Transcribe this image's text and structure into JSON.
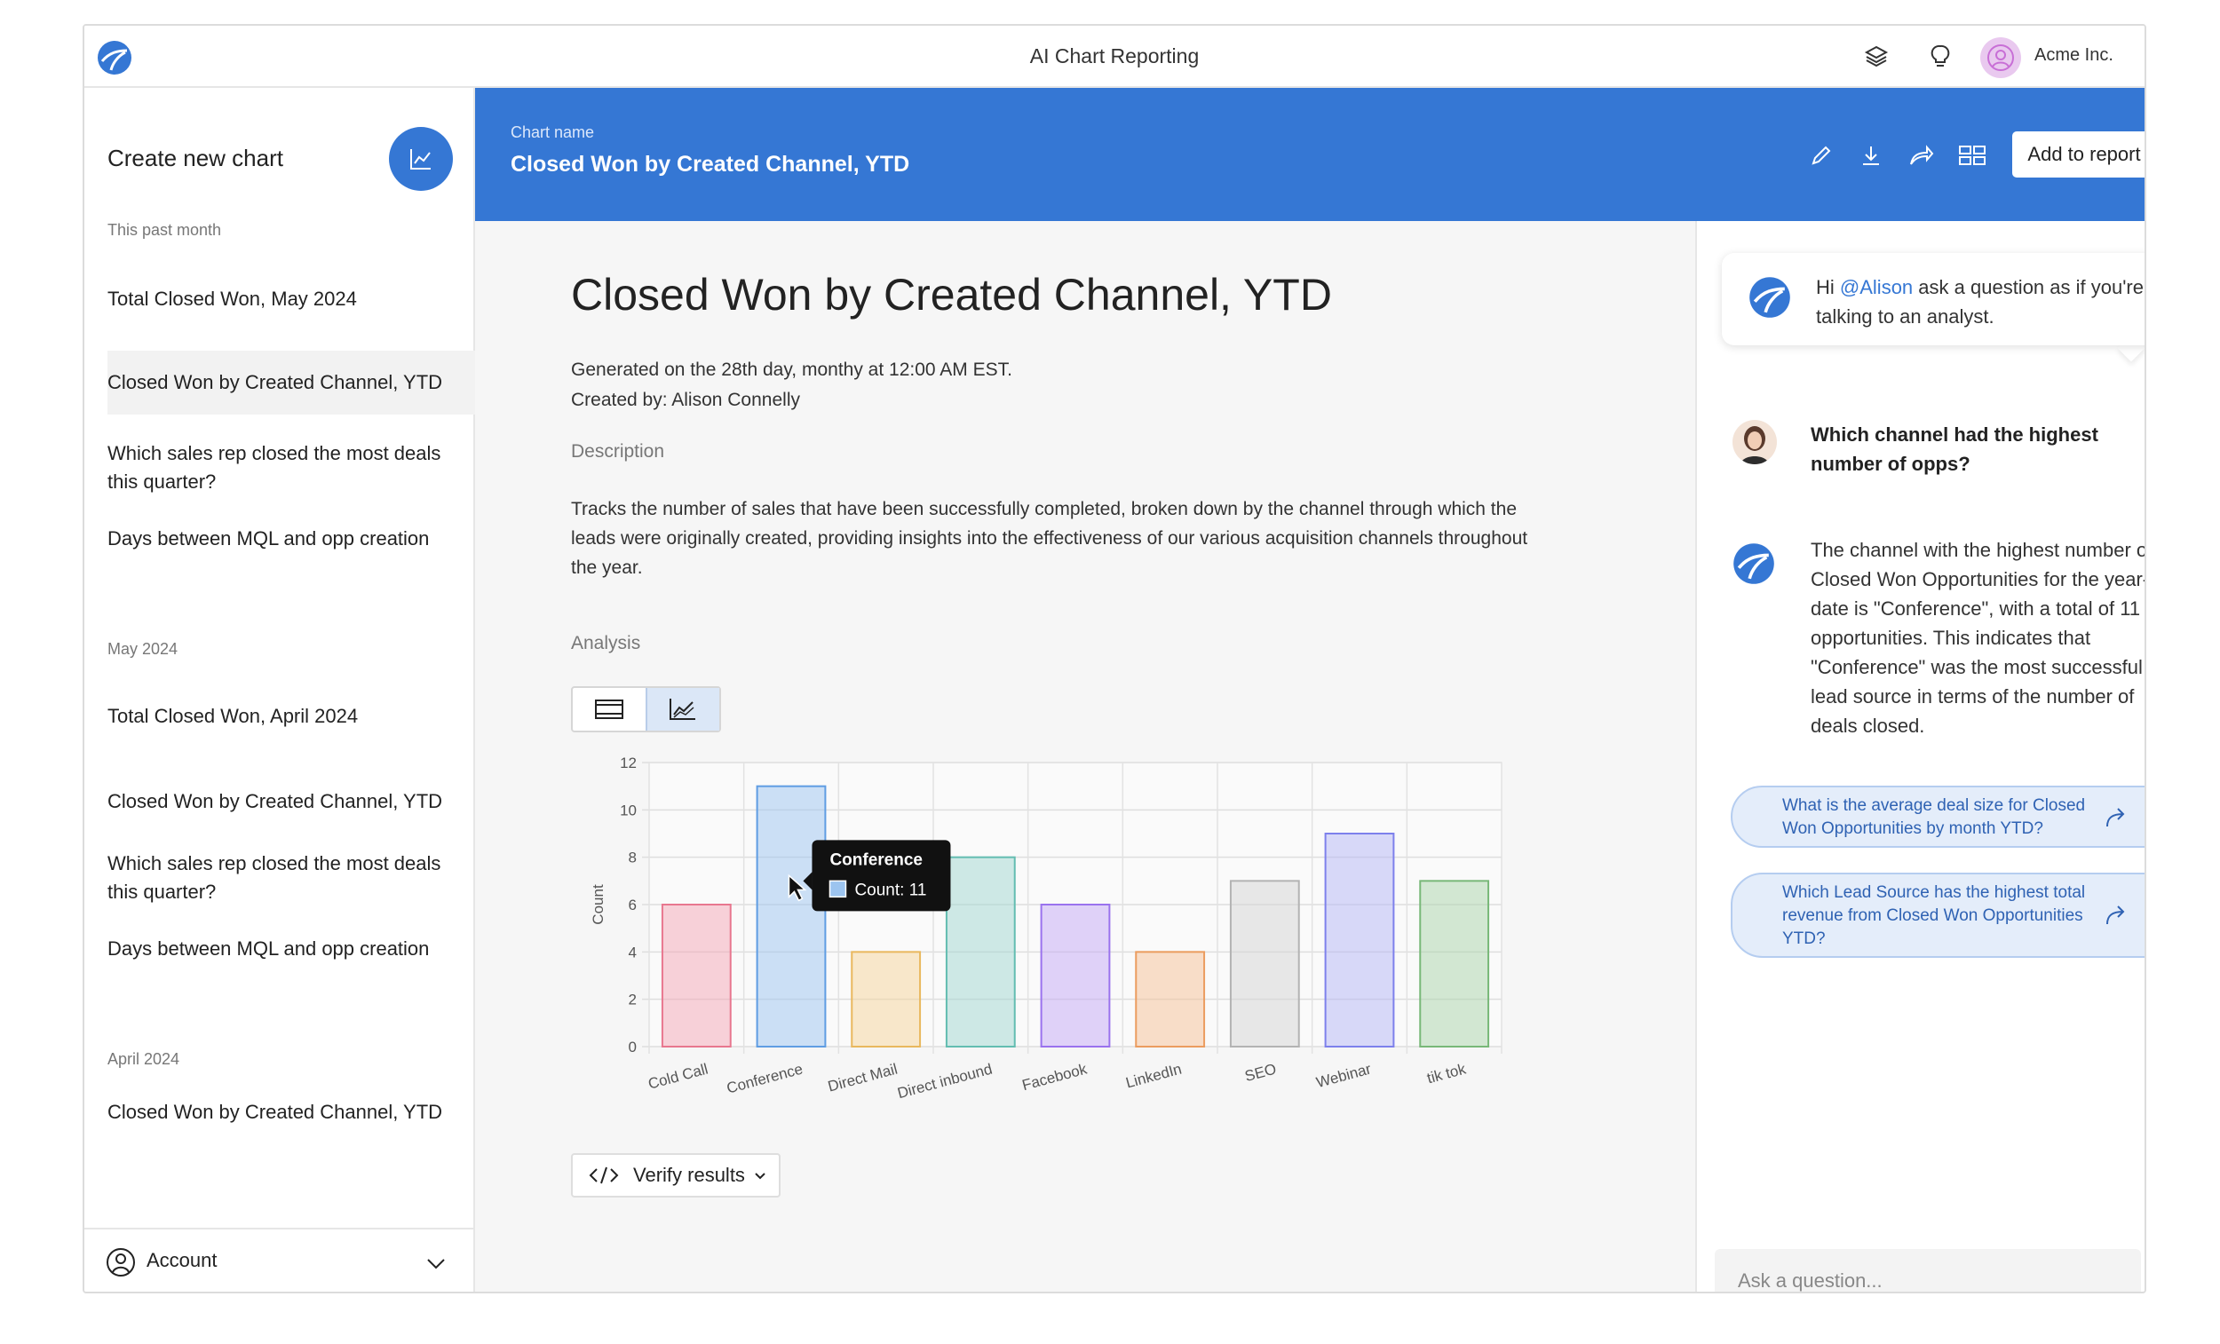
{
  "app": {
    "title": "AI Chart Reporting",
    "company": "Acme Inc."
  },
  "sidebar": {
    "create_label": "Create new chart",
    "sections": [
      {
        "label": "This past month",
        "items": [
          {
            "label": "Total Closed Won, May 2024"
          },
          {
            "label": "Closed Won by Created Channel, YTD",
            "active": true
          },
          {
            "label": "Which sales rep closed the most deals this quarter?"
          },
          {
            "label": "Days between MQL and opp creation"
          }
        ]
      },
      {
        "label": "May 2024",
        "items": [
          {
            "label": "Total Closed Won, April 2024"
          },
          {
            "label": "Closed Won by Created Channel, YTD"
          },
          {
            "label": "Which sales rep closed the most deals this quarter?"
          },
          {
            "label": "Days between MQL and opp creation"
          }
        ]
      },
      {
        "label": "April 2024",
        "items": [
          {
            "label": "Closed Won by Created Channel, YTD"
          }
        ]
      }
    ],
    "account_label": "Account"
  },
  "header": {
    "chart_name_label": "Chart name",
    "chart_name": "Closed Won by Created Channel, YTD",
    "add_to_report": "Add to report"
  },
  "report": {
    "title": "Closed Won by Created Channel, YTD",
    "generated": "Generated on the 28th day, monthy at 12:00 AM EST.",
    "created_by": "Created by: Alison Connelly",
    "description_label": "Description",
    "description": "Tracks the number of sales that have been successfully completed, broken down by the channel through which the leads were originally created, providing insights into the effectiveness of our various acquisition channels throughout the year.",
    "analysis_label": "Analysis",
    "verify_label": "Verify results"
  },
  "chart_data": {
    "type": "bar",
    "categories": [
      "Cold Call",
      "Conference",
      "Direct Mail",
      "Direct inbound",
      "Facebook",
      "LinkedIn",
      "SEO",
      "Webinar",
      "tik tok"
    ],
    "values": [
      6,
      11,
      4,
      8,
      6,
      4,
      7,
      9,
      7
    ],
    "ylabel": "Count",
    "ylim": [
      0,
      12
    ],
    "yticks": [
      0,
      2,
      4,
      6,
      8,
      10,
      12
    ],
    "grid": true,
    "colors": [
      "#f4a6b6",
      "#9cc4ef",
      "#f6d49a",
      "#9fd6cf",
      "#c3a8f5",
      "#f6c096",
      "#d4d4d4",
      "#b3b5f5",
      "#a9d4a9"
    ],
    "stroke_colors": [
      "#e8778f",
      "#5f9de3",
      "#e9b85e",
      "#63bdb1",
      "#9a72ee",
      "#eb9c5f",
      "#b3b3b3",
      "#7d80ec",
      "#78b878"
    ],
    "tooltip": {
      "title": "Conference",
      "label": "Count: 11"
    }
  },
  "chat": {
    "greeting_prefix": "Hi",
    "greeting_mention": "@Alison",
    "greeting_suffix": "ask a question as if you're talking to an analyst.",
    "user_question": "Which channel had the highest number of opps?",
    "bot_answer": "The channel with the highest number of Closed Won Opportunities for the year-to-date is \"Conference\", with a total of 11 opportunities. This indicates that \"Conference\" was the most successful lead source in terms of the number of deals closed.",
    "suggestions": [
      "What is the average deal size for Closed Won Opportunities by month YTD?",
      "Which Lead Source has the highest total revenue from Closed Won Opportunities YTD?"
    ],
    "input_placeholder": "Ask a question..."
  }
}
